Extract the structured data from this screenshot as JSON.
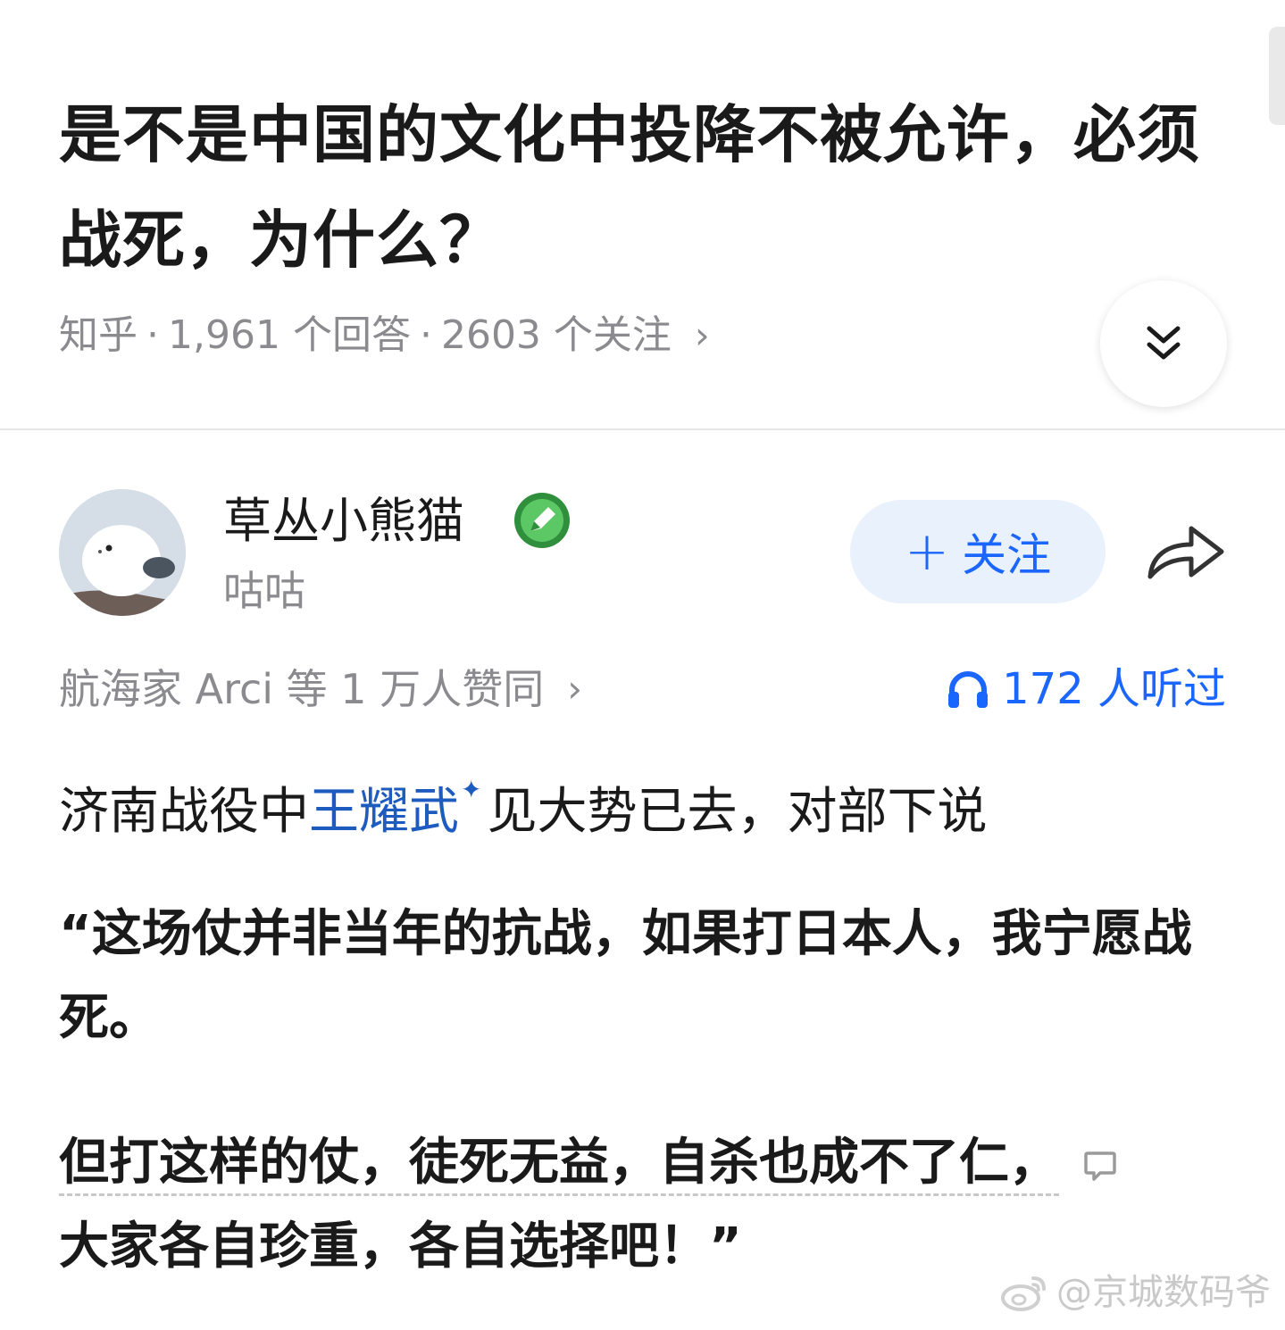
{
  "question": {
    "title": "是不是中国的文化中投降不被允许，必须战死，为什么？",
    "source": "知乎",
    "answers": "1,961 个回答",
    "followers": "2603 个关注",
    "separator": "·",
    "chevron": "›",
    "expand_icon": "double-chevron-down-icon"
  },
  "author": {
    "name": "草丛小熊猫",
    "bio": "咕咕",
    "badge_icon": "pen-badge-icon",
    "follow_label": "关注",
    "follow_plus": "+",
    "share_icon": "share-arrow-icon"
  },
  "stats": {
    "likes_text": "航海家 Arci 等 1 万人赞同",
    "likes_chevron": "›",
    "listen_text": "172 人听过"
  },
  "answer": {
    "p1_before": "济南战役中",
    "p1_link": "王耀武",
    "p1_spark": "✦",
    "p1_after": "见大势已去，对部下说",
    "p2": "“这场仗并非当年的抗战，如果打日本人，我宁愿战死。",
    "p3_underlined": "但打这样的仗，徒死无益，自杀也成不了仁，",
    "p3_rest": "大家各自珍重，各自选择吧！”"
  },
  "watermark": {
    "text": "@京城数码爷",
    "icon": "weibo-logo-icon"
  },
  "colors": {
    "accent_blue": "#1a66ff",
    "link_blue": "#1e5bbf",
    "meta_gray": "#8a8a8f",
    "follow_bg": "#e9f1fd",
    "badge_green": "#3fae4a"
  }
}
